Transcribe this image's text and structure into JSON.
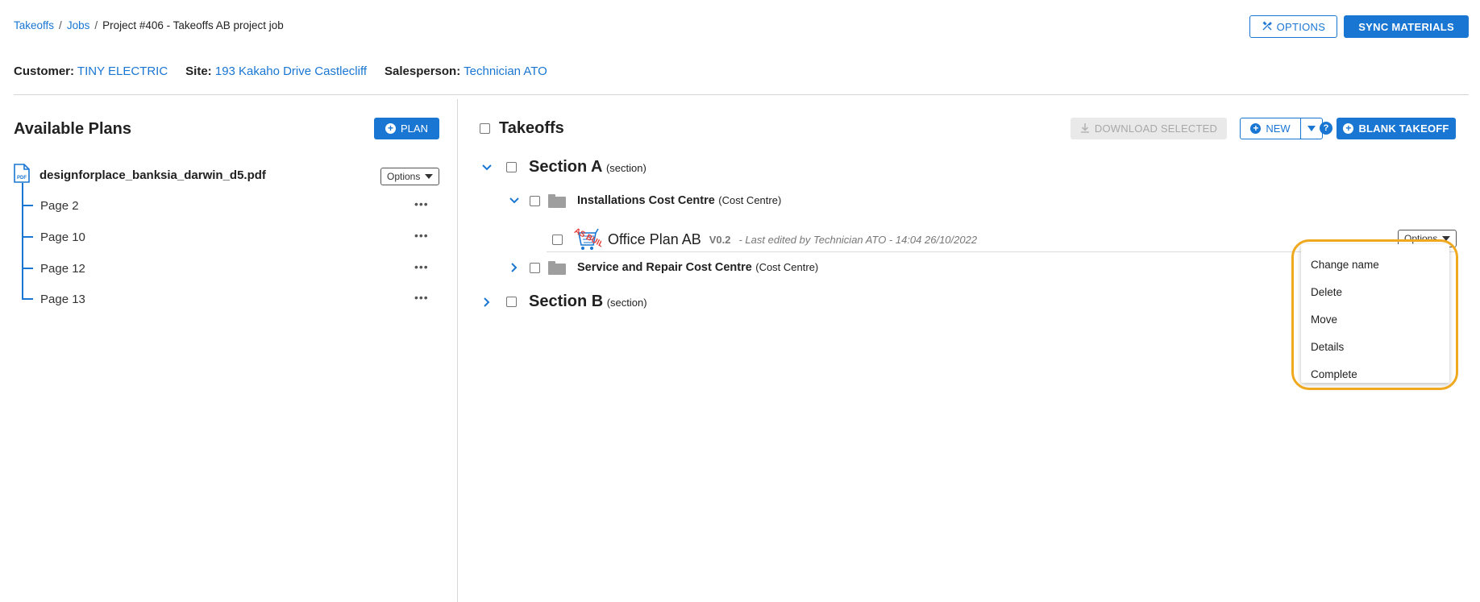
{
  "breadcrumb": {
    "items": [
      "Takeoffs",
      "Jobs",
      "Project #406 - Takeoffs AB project job"
    ],
    "separator": "/"
  },
  "top_actions": {
    "options_label": "OPTIONS",
    "sync_label": "SYNC MATERIALS"
  },
  "info": {
    "customer_label": "Customer:",
    "customer_value": "TINY ELECTRIC",
    "site_label": "Site:",
    "site_value": "193 Kakaho Drive Castlecliff",
    "salesperson_label": "Salesperson:",
    "salesperson_value": "Technician ATO"
  },
  "left_panel": {
    "title": "Available Plans",
    "plan_button": "PLAN",
    "file_name": "designforplace_banksia_darwin_d5.pdf",
    "file_icon": "PDF",
    "options_label": "Options",
    "pages": [
      "Page 2",
      "Page 10",
      "Page 12",
      "Page 13"
    ],
    "more_glyph": "•••"
  },
  "right_panel": {
    "title": "Takeoffs",
    "download_label": "DOWNLOAD SELECTED",
    "new_label": "NEW",
    "help_glyph": "?",
    "blank_label": "BLANK TAKEOFF",
    "sections": [
      {
        "name": "Section A",
        "tag": "(section)",
        "expanded": true
      },
      {
        "name": "Section B",
        "tag": "(section)",
        "expanded": false
      }
    ],
    "cost_centres": [
      {
        "name": "Installations Cost Centre",
        "tag": "(Cost Centre)",
        "expanded": true
      },
      {
        "name": "Service and Repair Cost Centre",
        "tag": "(Cost Centre)",
        "expanded": false
      }
    ],
    "takeoff": {
      "badge": "AS BUILT",
      "name": "Office Plan AB",
      "version": "V0.2",
      "edited": "- Last edited by Technician ATO - 14:04  26/10/2022",
      "options_label": "Options"
    }
  },
  "menu": {
    "items": [
      "Change name",
      "Delete",
      "Move",
      "Details",
      "Complete"
    ]
  },
  "colors": {
    "primary": "#1976d2",
    "highlight": "#f0a81e",
    "folder": "#9e9e9e"
  }
}
